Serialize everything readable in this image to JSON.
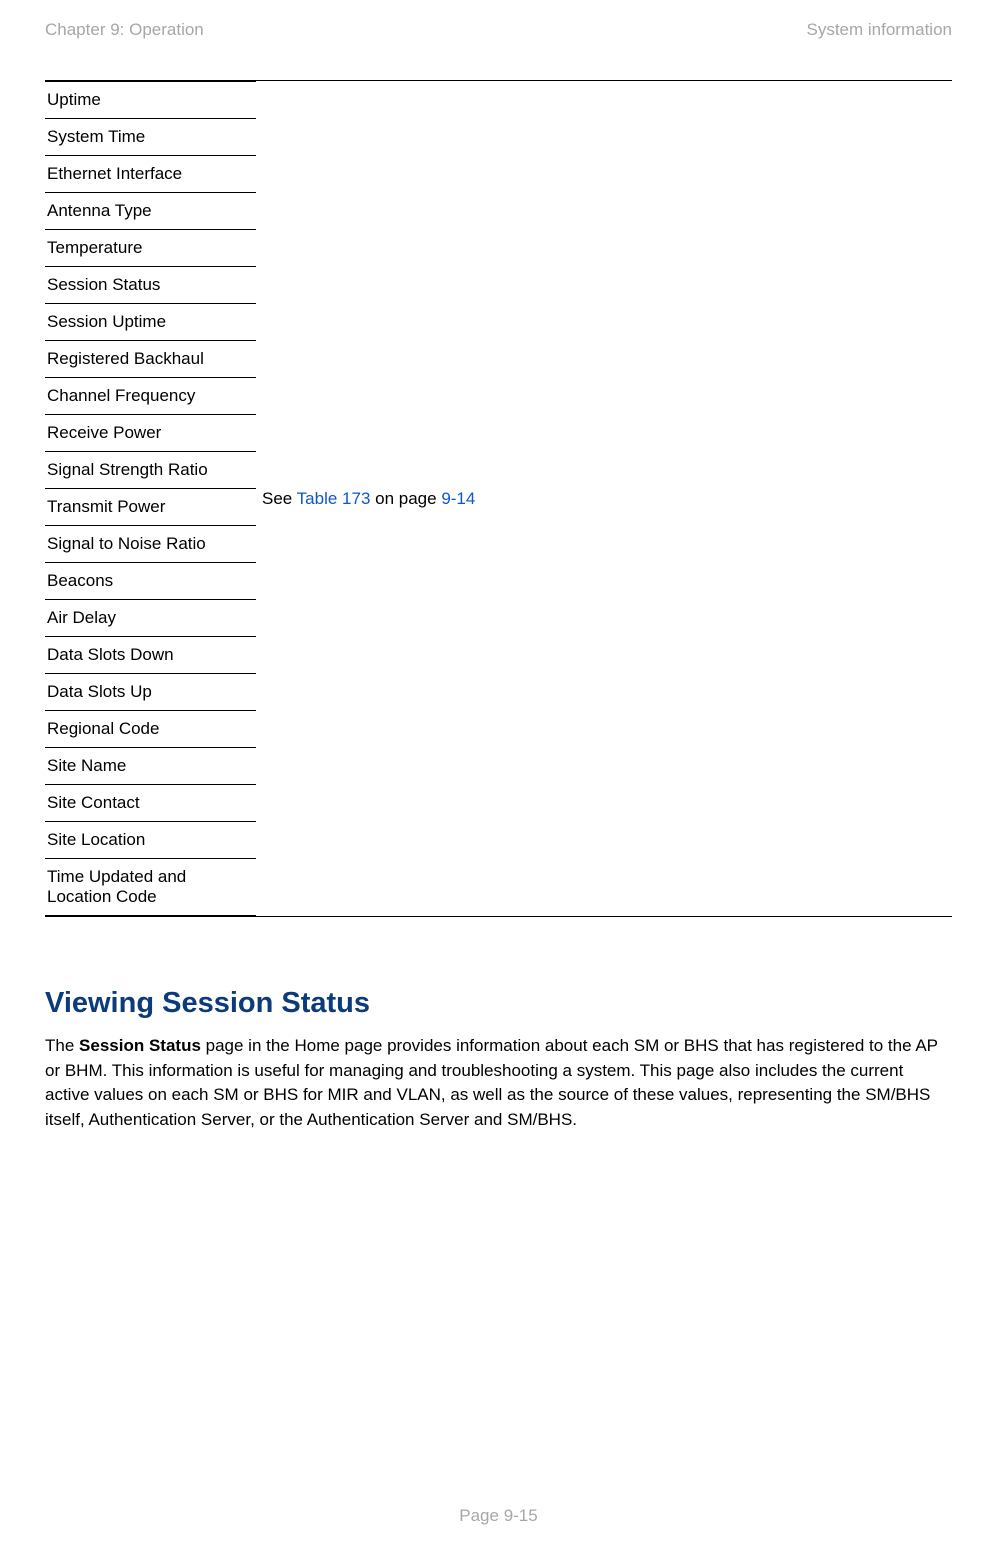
{
  "header": {
    "left": "Chapter 9:  Operation",
    "right": "System information"
  },
  "attributes": [
    "Uptime",
    "System Time",
    "Ethernet Interface",
    "Antenna Type",
    "Temperature",
    "Session Status",
    "Session Uptime",
    "Registered Backhaul",
    "Channel Frequency",
    "Receive Power",
    "Signal Strength Ratio",
    "Transmit Power",
    "Signal to Noise Ratio",
    "Beacons",
    "Air Delay",
    "Data Slots Down",
    "Data Slots Up",
    "Regional Code",
    "Site Name",
    "Site Contact",
    "Site Location",
    "Time Updated and Location Code"
  ],
  "desc": {
    "prefix": "See ",
    "link_table": "Table 173",
    "mid": " on page ",
    "link_page": "9-14"
  },
  "heading": "Viewing Session Status",
  "paragraph": {
    "prefix": "The ",
    "bold": "Session Status",
    "rest": " page in the Home page provides information about each SM or BHS that has registered to the AP or BHM. This information is useful for managing and troubleshooting a system. This page also includes the current active values on each SM or BHS for MIR and VLAN, as well as the source of these values, representing the SM/BHS itself, Authentication Server, or the Authentication Server and SM/BHS."
  },
  "footer": "Page 9-15"
}
